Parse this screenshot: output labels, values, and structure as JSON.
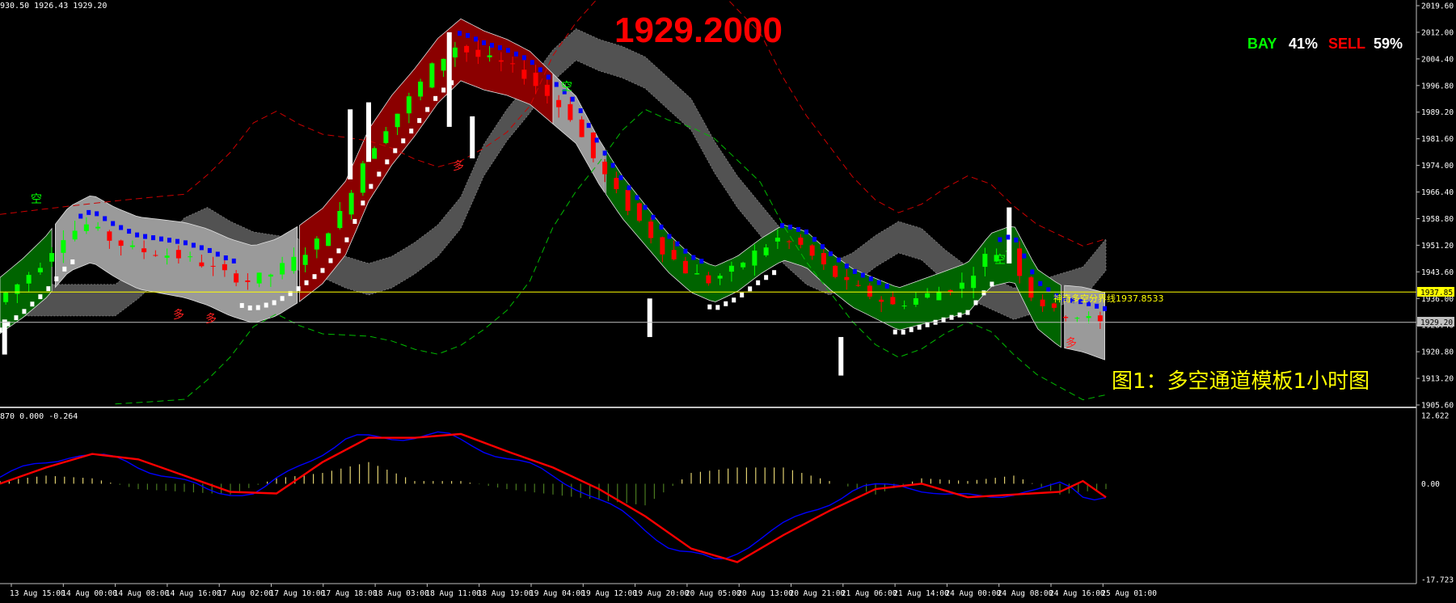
{
  "info_line": "930.50 1926.43 1929.20",
  "big_price": "1929.2000",
  "ratio": {
    "buy_label": "BAY",
    "buy_pct": "41%",
    "sell_label": "SELL",
    "sell_pct": "59%"
  },
  "caption": "图1：多空通道模板1小时图",
  "line_label": "神奇多空分界线1937.8533",
  "price_tags": {
    "yellow": "1937.85",
    "current": "1929.20"
  },
  "indicator_info": "870 0.000 -0.264",
  "marker_labels": {
    "long": "多",
    "empty": "空"
  },
  "colors": {
    "background": "#000000",
    "bull": "#00ff00",
    "bear": "#ff0000",
    "red_band": "#8b0000",
    "green_band": "#006400",
    "gray_band": "#6e6e6e",
    "blue_line": "#0000ff",
    "yellow_line": "#ffff00",
    "title_red": "#ff0000"
  },
  "chart_data": [
    {
      "type": "line",
      "title": "",
      "y_ticks": [
        "2019.60",
        "2012.00",
        "2004.40",
        "1996.80",
        "1989.20",
        "1981.60",
        "1974.00",
        "1966.40",
        "1958.80",
        "1951.20",
        "1943.60",
        "1936.00",
        "1928.40",
        "1920.80",
        "1913.20",
        "1905.60"
      ],
      "ylim": [
        1905.6,
        2019.6
      ],
      "x_ticks": [
        "13 Aug 15:00",
        "14 Aug 00:00",
        "14 Aug 08:00",
        "14 Aug 16:00",
        "17 Aug 02:00",
        "17 Aug 10:00",
        "17 Aug 18:00",
        "18 Aug 03:00",
        "18 Aug 11:00",
        "18 Aug 19:00",
        "19 Aug 04:00",
        "19 Aug 12:00",
        "19 Aug 20:00",
        "20 Aug 05:00",
        "20 Aug 13:00",
        "20 Aug 21:00",
        "21 Aug 06:00",
        "21 Aug 14:00",
        "24 Aug 00:00",
        "24 Aug 08:00",
        "24 Aug 16:00",
        "25 Aug 01:00"
      ],
      "close_path": [
        [
          0,
          1935
        ],
        [
          1,
          1940
        ],
        [
          2,
          1946
        ],
        [
          3,
          1954
        ],
        [
          4,
          1957
        ],
        [
          5,
          1953
        ],
        [
          6,
          1950
        ],
        [
          7,
          1949
        ],
        [
          8,
          1948
        ],
        [
          9,
          1946
        ],
        [
          10,
          1943
        ],
        [
          11,
          1941
        ],
        [
          12,
          1943
        ],
        [
          13,
          1947
        ],
        [
          14,
          1952
        ],
        [
          15,
          1960
        ],
        [
          16,
          1975
        ],
        [
          17,
          1985
        ],
        [
          18,
          1993
        ],
        [
          19,
          2002
        ],
        [
          20,
          2008
        ],
        [
          21,
          2005
        ],
        [
          22,
          2003
        ],
        [
          23,
          2000
        ],
        [
          24,
          1994
        ],
        [
          25,
          1988
        ],
        [
          26,
          1976
        ],
        [
          27,
          1966
        ],
        [
          28,
          1958
        ],
        [
          29,
          1950
        ],
        [
          30,
          1944
        ],
        [
          31,
          1941
        ],
        [
          32,
          1944
        ],
        [
          33,
          1949
        ],
        [
          34,
          1953
        ],
        [
          35,
          1951
        ],
        [
          36,
          1945
        ],
        [
          37,
          1940
        ],
        [
          38,
          1937
        ],
        [
          39,
          1934
        ],
        [
          40,
          1936
        ],
        [
          41,
          1938
        ],
        [
          42,
          1940
        ],
        [
          43,
          1948
        ],
        [
          44,
          1950
        ],
        [
          45,
          1937
        ],
        [
          46,
          1932
        ],
        [
          47,
          1931
        ],
        [
          48,
          1929
        ]
      ],
      "current_price": 1929.2,
      "divider_line": 1937.85
    },
    {
      "type": "line",
      "title": "",
      "y_ticks": [
        "12.622",
        "0.00",
        "-17.723"
      ],
      "ylim": [
        -17.723,
        12.622
      ],
      "signal": [
        [
          0,
          0
        ],
        [
          2,
          3
        ],
        [
          4,
          5.5
        ],
        [
          6,
          4.5
        ],
        [
          8,
          1.5
        ],
        [
          10,
          -1.5
        ],
        [
          12,
          -1.8
        ],
        [
          14,
          4
        ],
        [
          16,
          8.5
        ],
        [
          18,
          8.5
        ],
        [
          20,
          9.2
        ],
        [
          22,
          6
        ],
        [
          24,
          3
        ],
        [
          26,
          -1
        ],
        [
          28,
          -6
        ],
        [
          30,
          -12
        ],
        [
          32,
          -14.5
        ],
        [
          34,
          -9.5
        ],
        [
          36,
          -5
        ],
        [
          38,
          -1
        ],
        [
          40,
          0
        ],
        [
          42,
          -2.5
        ],
        [
          44,
          -2
        ],
        [
          46,
          -1.5
        ],
        [
          47,
          0.5
        ],
        [
          48,
          -2.5
        ]
      ],
      "histogram": [
        [
          0,
          0.5
        ],
        [
          2,
          1.5
        ],
        [
          4,
          1
        ],
        [
          6,
          -1
        ],
        [
          8,
          -1.5
        ],
        [
          10,
          -2
        ],
        [
          12,
          1
        ],
        [
          14,
          2
        ],
        [
          16,
          4
        ],
        [
          18,
          0.5
        ],
        [
          20,
          0.5
        ],
        [
          22,
          -1
        ],
        [
          24,
          -2
        ],
        [
          26,
          -3
        ],
        [
          28,
          -4
        ],
        [
          30,
          2
        ],
        [
          32,
          3
        ],
        [
          34,
          3
        ],
        [
          36,
          0.5
        ],
        [
          38,
          -2
        ],
        [
          40,
          1
        ],
        [
          42,
          0.5
        ],
        [
          44,
          1.5
        ],
        [
          46,
          -2
        ],
        [
          48,
          -1
        ]
      ]
    }
  ]
}
